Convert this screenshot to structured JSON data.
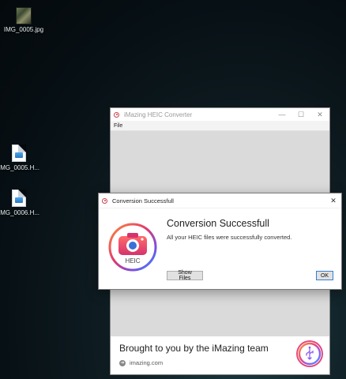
{
  "desktop": {
    "icons": [
      {
        "label": "IMG_0005.jpg"
      },
      {
        "label": "IMG_0005.H..."
      },
      {
        "label": "IMG_0006.H..."
      }
    ]
  },
  "main_window": {
    "title": "iMazing HEIC Converter",
    "controls": {
      "minimize": "—",
      "maximize": "☐",
      "close": "✕"
    },
    "menu": [
      "File"
    ],
    "brand": {
      "title": "Brought to you by the iMazing team",
      "link": "imazing.com"
    }
  },
  "dialog": {
    "title": "Conversion Successfull",
    "heading": "Conversion Successfull",
    "message": "All your HEIC files were successfully converted.",
    "icon_label": "HEIC",
    "buttons": {
      "show_files": "Show Files",
      "ok": "OK"
    },
    "close": "✕"
  },
  "colors": {
    "accent_red": "#c5474f",
    "ok_border": "#3a7bd5"
  }
}
